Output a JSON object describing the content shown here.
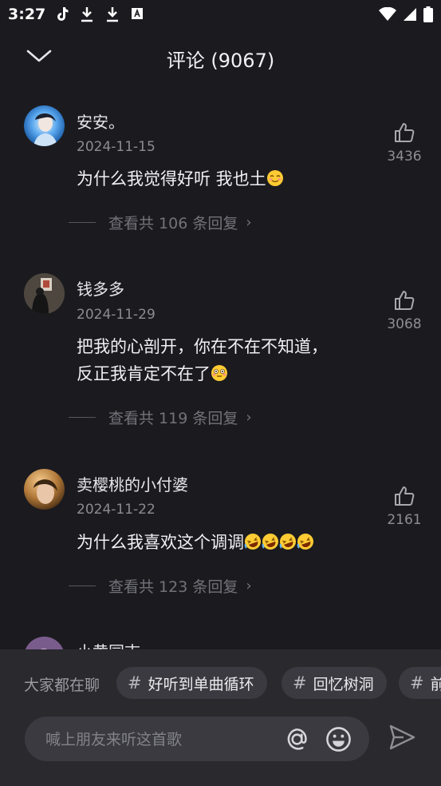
{
  "status_bar": {
    "time": "3:27"
  },
  "header": {
    "title": "评论 (9067)"
  },
  "comments": [
    {
      "name": "安安。",
      "date": "2024-11-15",
      "text": "为什么我觉得好听 我也土",
      "likes": "3436",
      "replies": "查看共 106 条回复"
    },
    {
      "name": "钱多多",
      "date": "2024-11-29",
      "text_line1": "把我的心剖开，你在不在不知道，",
      "text_line2": "反正我肯定不在了",
      "likes": "3068",
      "replies": "查看共 119 条回复"
    },
    {
      "name": "卖樱桃的小付婆",
      "date": "2024-11-22",
      "text": "为什么我喜欢这个调调",
      "likes": "2161",
      "replies": "查看共 123 条回复"
    },
    {
      "name": "小黄同志"
    }
  ],
  "topics": {
    "label": "大家都在聊",
    "items": [
      {
        "label": "好听到单曲循环"
      },
      {
        "label": "回忆树洞"
      },
      {
        "label": "前"
      }
    ]
  },
  "input": {
    "placeholder": "喊上朋友来听这首歌"
  }
}
